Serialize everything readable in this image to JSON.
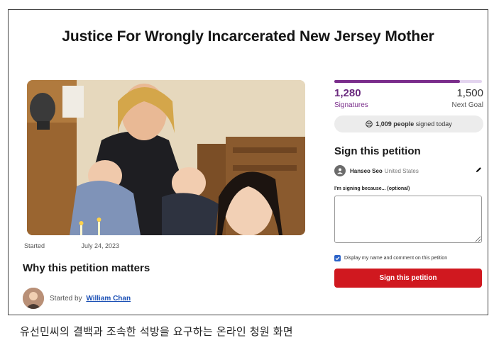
{
  "title": "Justice For Wrongly Incarcerated New Jersey Mother",
  "started": {
    "label": "Started",
    "date": "July 24, 2023"
  },
  "why_heading": "Why this petition matters",
  "starter": {
    "prefix": "Started by",
    "name": "William Chan"
  },
  "progress": {
    "current": "1,280",
    "goal": "1,500",
    "current_label": "Signatures",
    "goal_label": "Next Goal",
    "fraction": 0.853,
    "accent": "#7a2d8b"
  },
  "today": {
    "count": "1,009 people",
    "suffix": "signed today",
    "icon": "people-icon"
  },
  "sign_form": {
    "heading": "Sign this petition",
    "signer_name": "Hanseo Seo",
    "signer_country": "United States",
    "reason_label": "I'm signing because... (optional)",
    "reason_value": "",
    "display_label": "Display my name and comment on this petition",
    "display_checked": true,
    "button_label": "Sign this petition",
    "button_color": "#d0181f"
  },
  "caption": "유선민씨의 결백과 조속한 석방을 요구하는 온라인 청원 화면"
}
